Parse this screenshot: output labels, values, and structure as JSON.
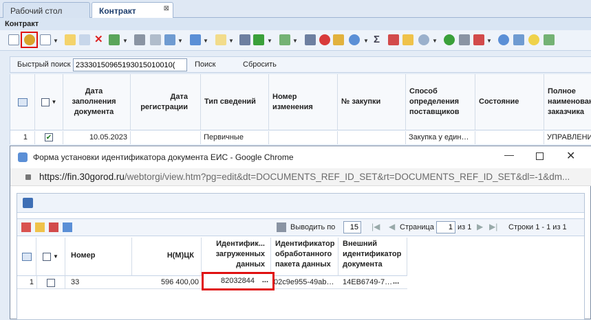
{
  "tabs": [
    {
      "label": "Рабочий стол"
    },
    {
      "label": "Контракт"
    }
  ],
  "tab_close": "⊠",
  "panel_title": "Контракт",
  "quick_search": {
    "label": "Быстрый поиск",
    "value": "23330150965193015010010(",
    "search_label": "Поиск",
    "reset_label": "Сбросить"
  },
  "main_grid": {
    "headers": [
      "Дата заполнения документа",
      "Дата регистрации",
      "Тип сведений",
      "Номер изменения",
      "№ закупки",
      "Способ определения поставщиков",
      "Состояние",
      "Полное наименование заказчика"
    ],
    "row": {
      "num": "1",
      "date": "10.05.2023",
      "type": "Первичные",
      "method": "Закупка у един…",
      "customer": "УПРАВЛЕНИ"
    }
  },
  "popup": {
    "title": "Форма установки идентификатора документа ЕИС - Google Chrome",
    "url_host": "https://fin.30gorod.ru",
    "url_path": "/webtorgi/view.htm?pg=edit&dt=DOCUMENTS_REF_ID_SET&rt=DOCUMENTS_REF_ID_SET&dl=-1&dm...",
    "pager": {
      "show_label": "Выводить по",
      "page_size": "15",
      "page_label": "Страница",
      "page": "1",
      "of_label": "из 1",
      "rows_label": "Строки 1 - 1 из 1"
    },
    "grid": {
      "headers": [
        "Номер",
        "Н(М)ЦК",
        "Идентифик... загруженных данных",
        "Идентификатор обработанного пакета данных",
        "Внешний идентификатор документа"
      ],
      "row": {
        "num": "1",
        "number": "33",
        "nmck": "596 400,00",
        "loaded_id": "82032844",
        "packet_id": "02c9e955-49ab…",
        "external_id": "14EB6749-7…",
        "ellipsis": "..."
      }
    }
  },
  "colors": {
    "highlight": "#e01010",
    "accent": "#1f3f6e"
  }
}
